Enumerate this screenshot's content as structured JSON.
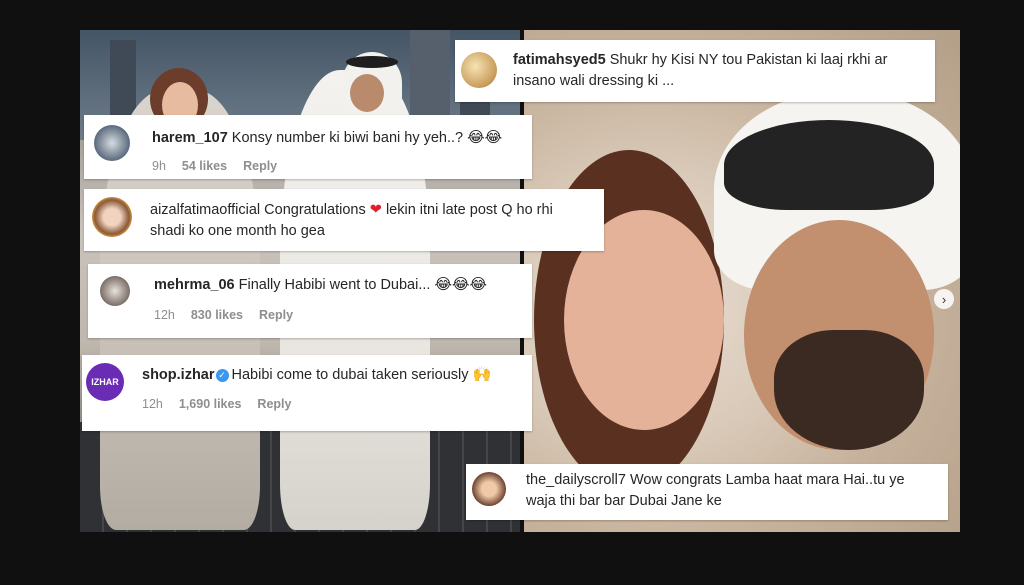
{
  "colors": {
    "background": "#101010",
    "card": "#ffffff",
    "text": "#262626",
    "meta": "#8e8e8e",
    "verified": "#3897f0",
    "heart": "#e0202d",
    "izhar_brand": "#6a2bb5"
  },
  "comments": [
    {
      "id": "fatimahsyed5",
      "username": "fatimahsyed5",
      "text": "Shukr hy Kisi NY tou Pakistan ki laaj rkhi ar insano wali dressing ki ...",
      "emoji": "",
      "time": "",
      "likes": "",
      "reply": ""
    },
    {
      "id": "harem_107",
      "username": "harem_107",
      "text": "Konsy number ki biwi bani hy yeh..?",
      "emoji": "😂😂",
      "time": "9h",
      "likes": "54 likes",
      "reply": "Reply"
    },
    {
      "id": "aizalfatimaofficial",
      "username": "aizalfatimaofficial",
      "text": "Congratulations",
      "heart": "❤",
      "text2": "lekin itni late post Q ho rhi shadi ko one month ho gea",
      "time": "",
      "likes": "",
      "reply": ""
    },
    {
      "id": "mehrma_06",
      "username": "mehrma_06",
      "text": "Finally Habibi went to Dubai...",
      "emoji": "😂😂😂",
      "time": "12h",
      "likes": "830 likes",
      "reply": "Reply"
    },
    {
      "id": "shop.izhar",
      "username": "shop.izhar",
      "avatar_text": "IZHAR",
      "verified_icon": "✓",
      "text": "Habibi come to dubai taken seriously",
      "emoji": "🙌",
      "time": "12h",
      "likes": "1,690 likes",
      "reply": "Reply"
    },
    {
      "id": "the_dailyscroll7",
      "username": "the_dailyscroll7",
      "text": "Wow congrats Lamba haat mara Hai..tu ye waja thi bar bar Dubai Jane ke",
      "emoji": "",
      "time": "",
      "likes": "",
      "reply": ""
    }
  ],
  "carousel": {
    "next_icon": "›"
  },
  "icons": {
    "next": "chevron-right-icon",
    "verified": "verified-badge-icon",
    "heart": "red-heart-icon"
  }
}
